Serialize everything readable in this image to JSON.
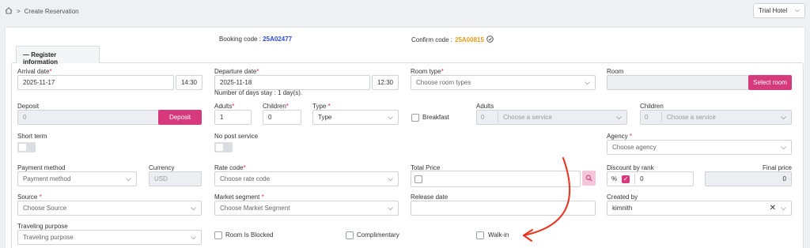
{
  "breadcrumb": {
    "separator": ">",
    "page": "Create Reservation"
  },
  "hotel": {
    "selected": "Trial Hotel"
  },
  "codes": {
    "booking_label": "Booking code :",
    "booking_value": "25A02477",
    "confirm_label": "Confirm code :",
    "confirm_value": "25A00815"
  },
  "section": {
    "title": "Register information",
    "collapse_symbol": "—"
  },
  "form": {
    "arrival": {
      "label": "Arrival date",
      "date": "2025-11-17",
      "time": "14:30"
    },
    "departure": {
      "label": "Departure date",
      "date": "2025-11-18",
      "time": "12:30",
      "stay_note": "Number of days stay : 1 day(s)."
    },
    "room_type": {
      "label": "Room type",
      "placeholder": "Choose room types"
    },
    "room": {
      "label": "Room",
      "button": "Select room"
    },
    "deposit": {
      "label": "Deposit",
      "value": "0",
      "button": "Deposit"
    },
    "adults": {
      "label": "Adults",
      "value": "1"
    },
    "children": {
      "label": "Children",
      "value": "0"
    },
    "type": {
      "label": "Type",
      "placeholder": "Type"
    },
    "breakfast": {
      "label": "Breakfast",
      "adults_label": "Adults",
      "adults_value": "0",
      "adults_placeholder": "Choose a service",
      "children_label": "Children",
      "children_value": "0",
      "children_placeholder": "Choose a service"
    },
    "short_term": {
      "label": "Short term"
    },
    "no_post": {
      "label": "No post service"
    },
    "agency": {
      "label": "Agency",
      "placeholder": "Choose agency"
    },
    "payment_method": {
      "label": "Payment method",
      "value": "Payment method"
    },
    "currency": {
      "label": "Currency",
      "value": "USD"
    },
    "rate_code": {
      "label": "Rate code",
      "placeholder": "Choose rate code"
    },
    "total_price": {
      "label": "Total Price"
    },
    "discount": {
      "label": "Discount by rank",
      "symbol": "%",
      "value": "0"
    },
    "final_price": {
      "label": "Final price",
      "value": "0"
    },
    "source": {
      "label": "Source",
      "placeholder": "Choose Source"
    },
    "market_segment": {
      "label": "Market segment",
      "placeholder": "Choose Market Segment"
    },
    "release_date": {
      "label": "Release date"
    },
    "created_by": {
      "label": "Created by",
      "value": "kimnith"
    },
    "traveling_purpose": {
      "label": "Traveling purpose",
      "placeholder": "Traveling purpose"
    },
    "room_blocked": {
      "label": "Room Is Blocked"
    },
    "complimentary": {
      "label": "Complimentary"
    },
    "walk_in": {
      "label": "Walk-in"
    }
  },
  "colors": {
    "accent_pink": "#d63a7c",
    "booking_blue": "#2b4bd6",
    "confirm_orange": "#e89a1a",
    "annotation_red": "#e8321e"
  },
  "icons": {
    "home": "home-icon",
    "chevron": "chevron-down-icon",
    "search": "search-icon",
    "clear": "close-icon",
    "info": "circle-check-icon"
  }
}
